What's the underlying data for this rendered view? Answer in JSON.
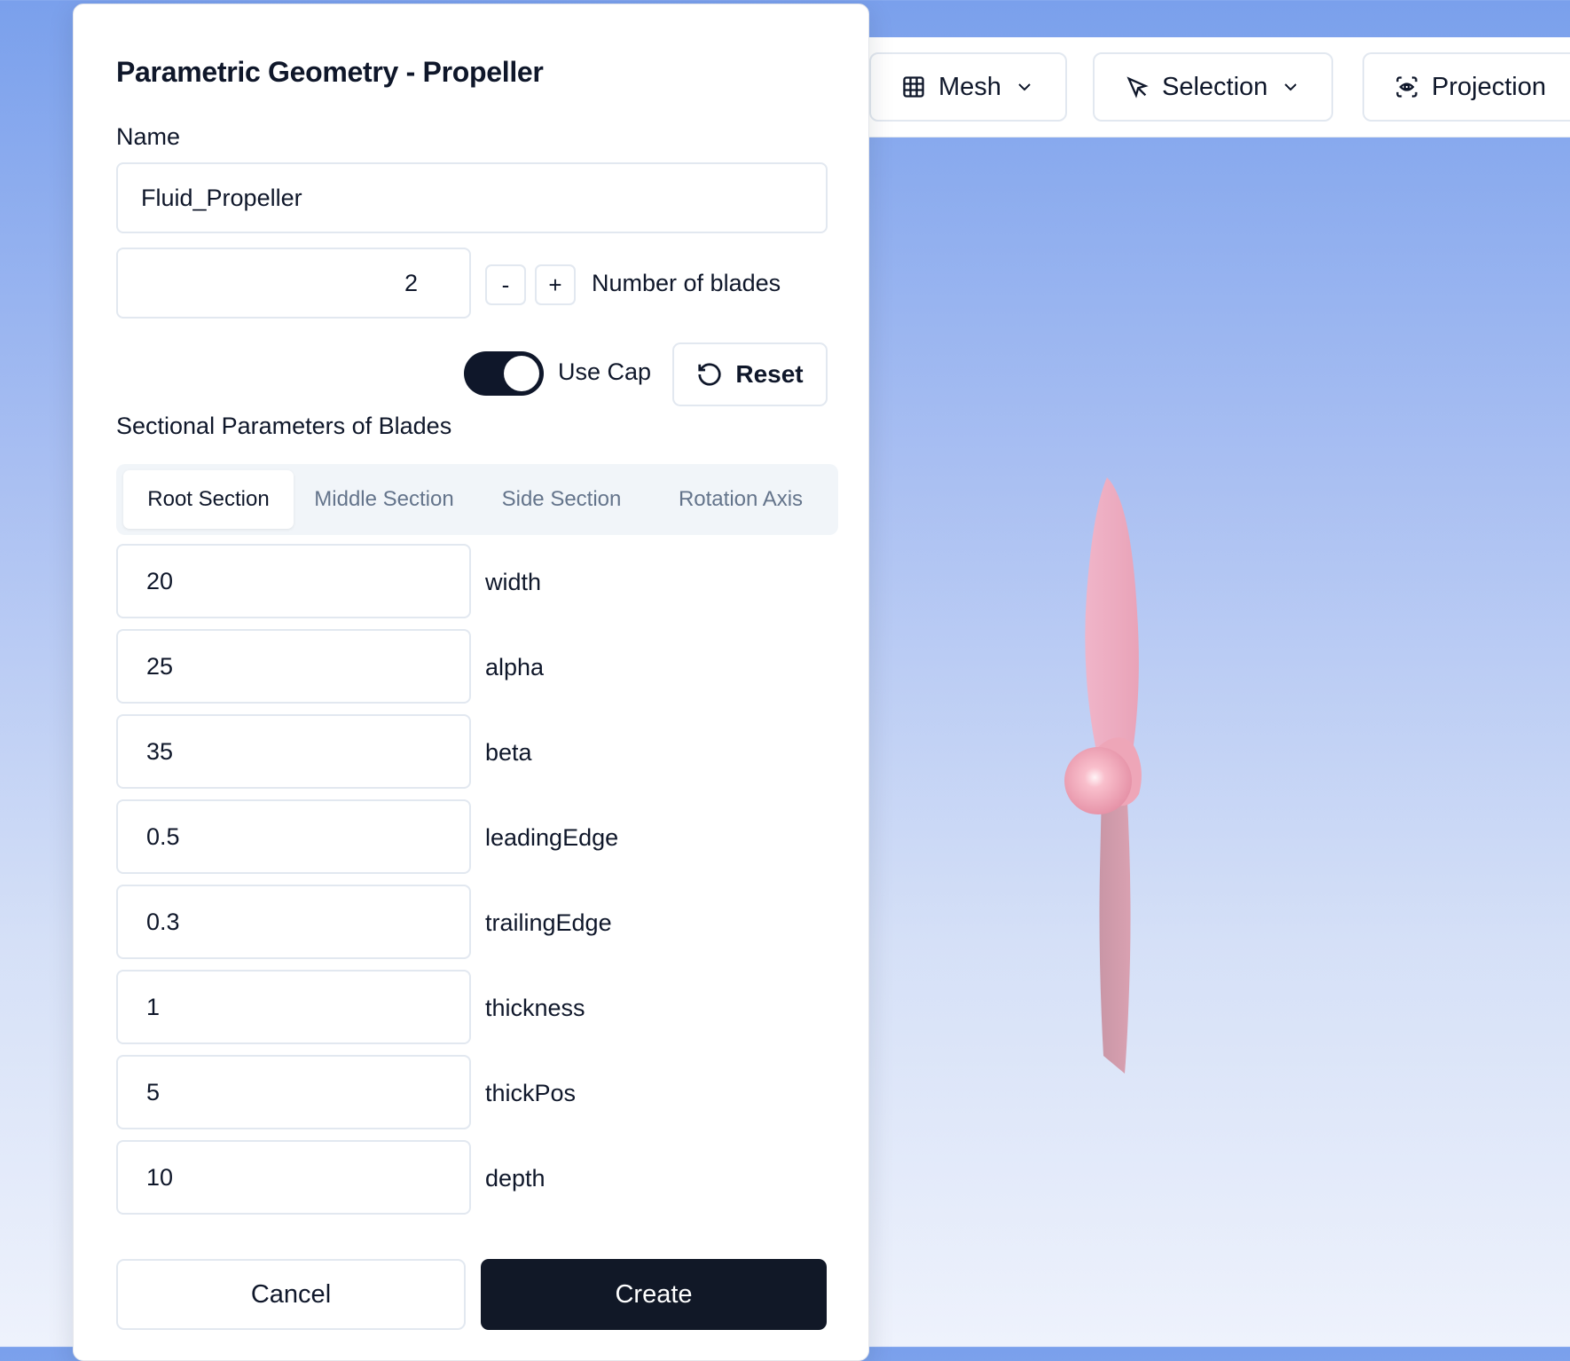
{
  "toolbar": {
    "mesh_label": "Mesh",
    "selection_label": "Selection",
    "projection_label": "Projection"
  },
  "dialog": {
    "title": "Parametric Geometry - Propeller",
    "name_label": "Name",
    "name_value": "Fluid_Propeller",
    "blades_value": "2",
    "minus_label": "-",
    "plus_label": "+",
    "blades_label": "Number of blades",
    "use_cap_label": "Use Cap",
    "use_cap_on": true,
    "reset_label": "Reset",
    "section_heading": "Sectional Parameters of Blades",
    "tabs": [
      {
        "label": "Root Section",
        "active": true
      },
      {
        "label": "Middle Section",
        "active": false
      },
      {
        "label": "Side Section",
        "active": false
      },
      {
        "label": "Rotation Axis",
        "active": false
      }
    ],
    "params": [
      {
        "value": "20",
        "label": "width"
      },
      {
        "value": "25",
        "label": "alpha"
      },
      {
        "value": "35",
        "label": "beta"
      },
      {
        "value": "0.5",
        "label": "leadingEdge"
      },
      {
        "value": "0.3",
        "label": "trailingEdge"
      },
      {
        "value": "1",
        "label": "thickness"
      },
      {
        "value": "5",
        "label": "thickPos"
      },
      {
        "value": "10",
        "label": "depth"
      }
    ],
    "cancel_label": "Cancel",
    "create_label": "Create"
  },
  "colors": {
    "primary": "#111827",
    "border": "#e2e8f0",
    "viewport_top": "#7aa0ec",
    "viewport_bottom": "#eef2fc",
    "propeller": "#f2a9bd"
  },
  "icons": {
    "mesh": "grid-icon",
    "selection": "cursor-arrow-icon",
    "projection": "eye-scan-icon",
    "reset": "rotate-ccw-icon",
    "dropdown": "chevron-down-icon"
  }
}
